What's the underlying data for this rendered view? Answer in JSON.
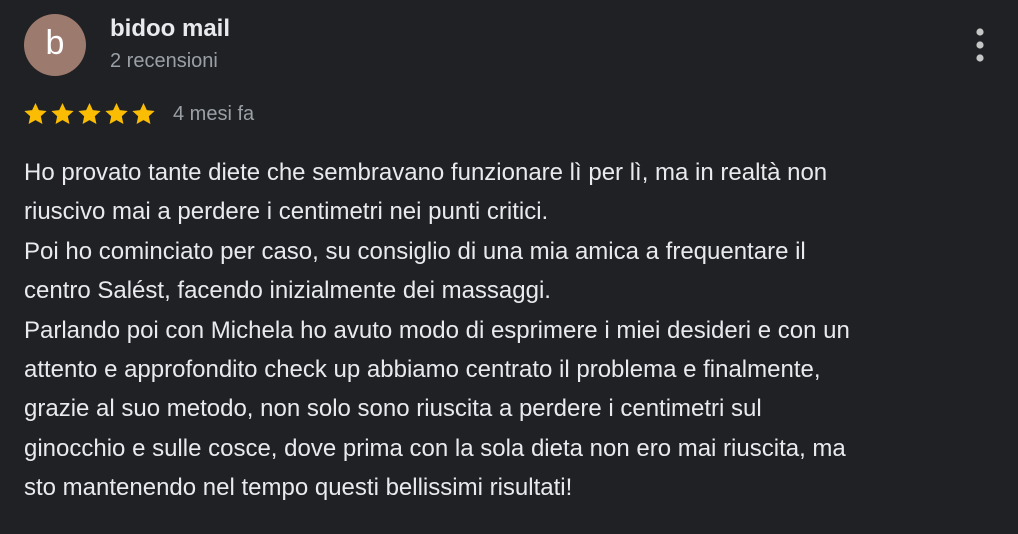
{
  "review": {
    "author": {
      "avatar_initial": "b",
      "avatar_color": "#9d7a6e",
      "name": "bidoo mail",
      "meta": "2 recensioni"
    },
    "menu_icon": "more-vert-icon",
    "rating": {
      "stars": 5,
      "max_stars": 5,
      "star_color": "#fbbc04",
      "date": "4 mesi fa"
    },
    "text_lines": [
      "Ho provato tante diete che sembravano funzionare lì per lì, ma in realtà non",
      "riuscivo mai a perdere i centimetri nei punti critici.",
      "Poi ho cominciato per caso, su consiglio di una mia amica a frequentare il",
      "centro Salést, facendo inizialmente dei massaggi.",
      "Parlando poi con Michela ho avuto modo di esprimere i miei desideri e con un",
      "attento e approfondito check up abbiamo centrato il problema e finalmente,",
      "grazie al suo metodo, non solo sono riuscita a perdere i centimetri sul",
      "ginocchio e sulle cosce, dove prima con la sola dieta non ero mai riuscita, ma",
      "sto mantenendo nel tempo questi bellissimi risultati!"
    ]
  }
}
